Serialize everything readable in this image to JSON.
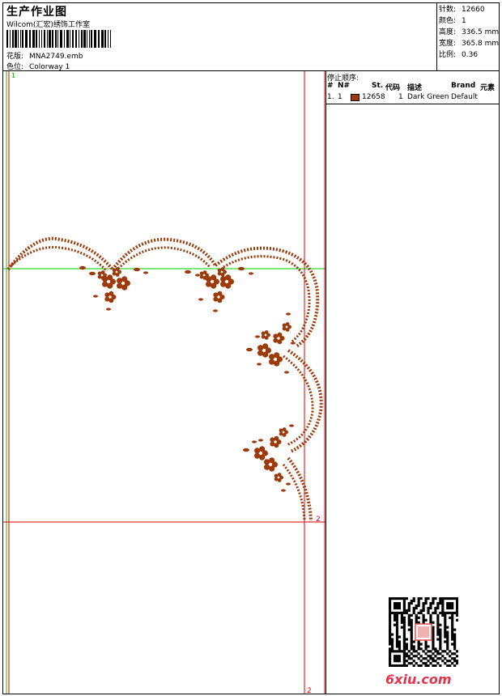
{
  "header": {
    "title": "生产作业图",
    "company": "Wilcom(汇宏)绣饰工作室",
    "design_label": "花版:",
    "design_value": "MNA2749.emb",
    "colorway_label": "色位:",
    "colorway_value": "Colorway 1"
  },
  "stats": [
    {
      "label": "针数:",
      "value": "12660"
    },
    {
      "label": "颜色:",
      "value": "1"
    },
    {
      "label": "高度:",
      "value": "336.5 mm"
    },
    {
      "label": "宽度:",
      "value": "365.8 mm"
    },
    {
      "label": "比例:",
      "value": "0.36"
    }
  ],
  "stop_sequence": {
    "title": "停止顺序:",
    "columns": [
      "#",
      "N#",
      "St.",
      "代码",
      "描述",
      "Brand",
      "元素"
    ],
    "rows": [
      {
        "index": "1.",
        "needle": "1",
        "stitches": "12658",
        "code": "1",
        "description": "Dark Green",
        "brand": "Default",
        "element": "",
        "color": "#9b3a0b"
      }
    ]
  },
  "canvas": {
    "markers": {
      "top_left": "1",
      "right_mid": "2",
      "right_bottom": "2"
    },
    "thread_color": "#9b3a0b",
    "guide_green": "#00cc00",
    "guide_red": "#e00000"
  },
  "logo": "6xiu.com"
}
